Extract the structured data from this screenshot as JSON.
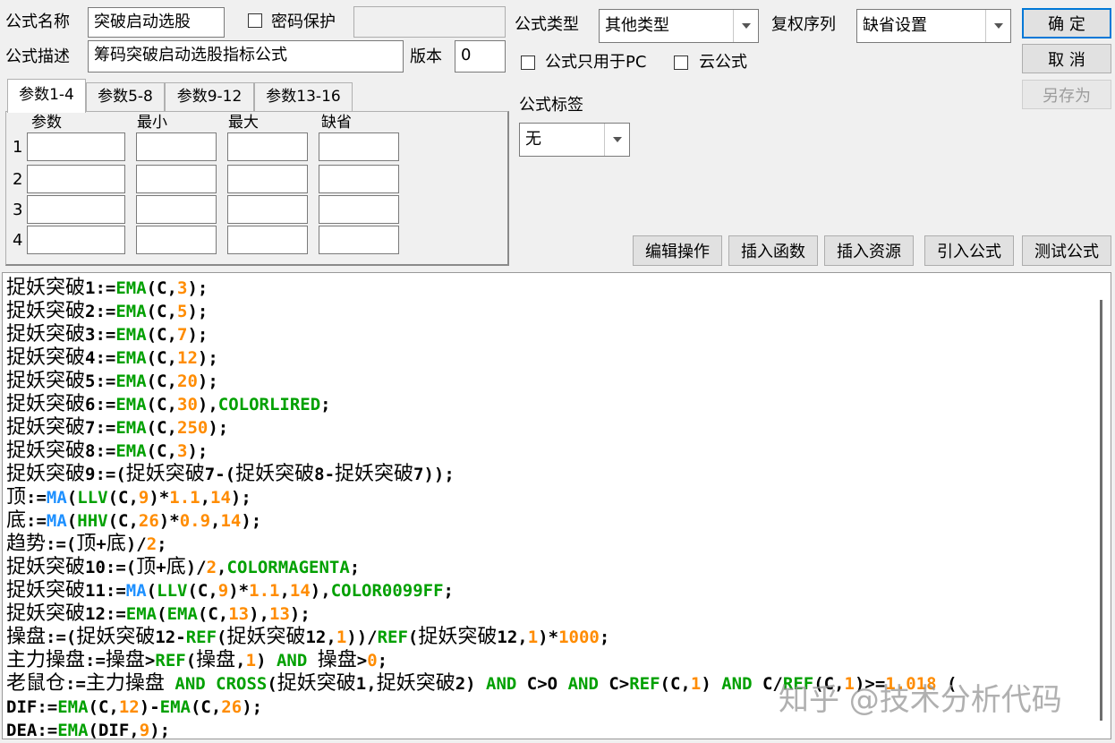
{
  "form": {
    "name_label": "公式名称",
    "name_value": "突破启动选股",
    "password_label": "密码保护",
    "desc_label": "公式描述",
    "desc_value": "筹码突破启动选股指标公式",
    "version_label": "版本",
    "version_value": "0",
    "type_label": "公式类型",
    "type_value": "其他类型",
    "rights_label": "复权序列",
    "rights_value": "缺省设置",
    "pc_only_label": "公式只用于PC",
    "cloud_label": "云公式",
    "tag_label": "公式标签",
    "tag_value": "无"
  },
  "buttons": {
    "ok": "确 定",
    "cancel": "取 消",
    "save_as": "另存为",
    "edit": "编辑操作",
    "insert_func": "插入函数",
    "insert_res": "插入资源",
    "import": "引入公式",
    "test": "测试公式"
  },
  "tabs": [
    {
      "label": "参数1-4"
    },
    {
      "label": "参数5-8"
    },
    {
      "label": "参数9-12"
    },
    {
      "label": "参数13-16"
    }
  ],
  "params": {
    "headers": [
      "参数",
      "最小",
      "最大",
      "缺省"
    ],
    "rows": [
      "1",
      "2",
      "3",
      "4"
    ]
  },
  "colors": {
    "func": "#00a000",
    "func_blue": "#1e90ff",
    "num": "#ff8c00",
    "text": "#000000"
  },
  "code_lines": [
    [
      [
        "c",
        "捉妖突破"
      ],
      [
        "t",
        "1:="
      ],
      [
        "f",
        "EMA"
      ],
      [
        "t",
        "(C,"
      ],
      [
        "n",
        "3"
      ],
      [
        "t",
        ");"
      ]
    ],
    [
      [
        "c",
        "捉妖突破"
      ],
      [
        "t",
        "2:="
      ],
      [
        "f",
        "EMA"
      ],
      [
        "t",
        "(C,"
      ],
      [
        "n",
        "5"
      ],
      [
        "t",
        ");"
      ]
    ],
    [
      [
        "c",
        "捉妖突破"
      ],
      [
        "t",
        "3:="
      ],
      [
        "f",
        "EMA"
      ],
      [
        "t",
        "(C,"
      ],
      [
        "n",
        "7"
      ],
      [
        "t",
        ");"
      ]
    ],
    [
      [
        "c",
        "捉妖突破"
      ],
      [
        "t",
        "4:="
      ],
      [
        "f",
        "EMA"
      ],
      [
        "t",
        "(C,"
      ],
      [
        "n",
        "12"
      ],
      [
        "t",
        ");"
      ]
    ],
    [
      [
        "c",
        "捉妖突破"
      ],
      [
        "t",
        "5:="
      ],
      [
        "f",
        "EMA"
      ],
      [
        "t",
        "(C,"
      ],
      [
        "n",
        "20"
      ],
      [
        "t",
        ");"
      ]
    ],
    [
      [
        "c",
        "捉妖突破"
      ],
      [
        "t",
        "6:="
      ],
      [
        "f",
        "EMA"
      ],
      [
        "t",
        "(C,"
      ],
      [
        "n",
        "30"
      ],
      [
        "t",
        "),"
      ],
      [
        "f",
        "COLORLIRED"
      ],
      [
        "t",
        ";"
      ]
    ],
    [
      [
        "c",
        "捉妖突破"
      ],
      [
        "t",
        "7:="
      ],
      [
        "f",
        "EMA"
      ],
      [
        "t",
        "(C,"
      ],
      [
        "n",
        "250"
      ],
      [
        "t",
        ");"
      ]
    ],
    [
      [
        "c",
        "捉妖突破"
      ],
      [
        "t",
        "8:="
      ],
      [
        "f",
        "EMA"
      ],
      [
        "t",
        "(C,"
      ],
      [
        "n",
        "3"
      ],
      [
        "t",
        ");"
      ]
    ],
    [
      [
        "c",
        "捉妖突破"
      ],
      [
        "t",
        "9:=("
      ],
      [
        "c",
        "捉妖突破"
      ],
      [
        "t",
        "7-("
      ],
      [
        "c",
        "捉妖突破"
      ],
      [
        "t",
        "8-"
      ],
      [
        "c",
        "捉妖突破"
      ],
      [
        "t",
        "7));"
      ]
    ],
    [
      [
        "c",
        "顶"
      ],
      [
        "t",
        ":="
      ],
      [
        "b",
        "MA"
      ],
      [
        "t",
        "("
      ],
      [
        "f",
        "LLV"
      ],
      [
        "t",
        "(C,"
      ],
      [
        "n",
        "9"
      ],
      [
        "t",
        ")*"
      ],
      [
        "n",
        "1.1"
      ],
      [
        "t",
        ","
      ],
      [
        "n",
        "14"
      ],
      [
        "t",
        ");"
      ]
    ],
    [
      [
        "c",
        "底"
      ],
      [
        "t",
        ":="
      ],
      [
        "b",
        "MA"
      ],
      [
        "t",
        "("
      ],
      [
        "f",
        "HHV"
      ],
      [
        "t",
        "(C,"
      ],
      [
        "n",
        "26"
      ],
      [
        "t",
        ")*"
      ],
      [
        "n",
        "0.9"
      ],
      [
        "t",
        ","
      ],
      [
        "n",
        "14"
      ],
      [
        "t",
        ");"
      ]
    ],
    [
      [
        "c",
        "趋势"
      ],
      [
        "t",
        ":=("
      ],
      [
        "c",
        "顶"
      ],
      [
        "t",
        "+"
      ],
      [
        "c",
        "底"
      ],
      [
        "t",
        ")/"
      ],
      [
        "n",
        "2"
      ],
      [
        "t",
        ";"
      ]
    ],
    [
      [
        "c",
        "捉妖突破"
      ],
      [
        "t",
        "10:=("
      ],
      [
        "c",
        "顶"
      ],
      [
        "t",
        "+"
      ],
      [
        "c",
        "底"
      ],
      [
        "t",
        ")/"
      ],
      [
        "n",
        "2"
      ],
      [
        "t",
        ","
      ],
      [
        "f",
        "COLORMAGENTA"
      ],
      [
        "t",
        ";"
      ]
    ],
    [
      [
        "c",
        "捉妖突破"
      ],
      [
        "t",
        "11:="
      ],
      [
        "b",
        "MA"
      ],
      [
        "t",
        "("
      ],
      [
        "f",
        "LLV"
      ],
      [
        "t",
        "(C,"
      ],
      [
        "n",
        "9"
      ],
      [
        "t",
        ")*"
      ],
      [
        "n",
        "1.1"
      ],
      [
        "t",
        ","
      ],
      [
        "n",
        "14"
      ],
      [
        "t",
        "),"
      ],
      [
        "f",
        "COLOR0099FF"
      ],
      [
        "t",
        ";"
      ]
    ],
    [
      [
        "c",
        "捉妖突破"
      ],
      [
        "t",
        "12:="
      ],
      [
        "f",
        "EMA"
      ],
      [
        "t",
        "("
      ],
      [
        "f",
        "EMA"
      ],
      [
        "t",
        "(C,"
      ],
      [
        "n",
        "13"
      ],
      [
        "t",
        "),"
      ],
      [
        "n",
        "13"
      ],
      [
        "t",
        ");"
      ]
    ],
    [
      [
        "c",
        "操盘"
      ],
      [
        "t",
        ":=("
      ],
      [
        "c",
        "捉妖突破"
      ],
      [
        "t",
        "12-"
      ],
      [
        "f",
        "REF"
      ],
      [
        "t",
        "("
      ],
      [
        "c",
        "捉妖突破"
      ],
      [
        "t",
        "12,"
      ],
      [
        "n",
        "1"
      ],
      [
        "t",
        "))/"
      ],
      [
        "f",
        "REF"
      ],
      [
        "t",
        "("
      ],
      [
        "c",
        "捉妖突破"
      ],
      [
        "t",
        "12,"
      ],
      [
        "n",
        "1"
      ],
      [
        "t",
        ")*"
      ],
      [
        "n",
        "1000"
      ],
      [
        "t",
        ";"
      ]
    ],
    [
      [
        "c",
        "主力操盘"
      ],
      [
        "t",
        ":="
      ],
      [
        "c",
        "操盘"
      ],
      [
        "t",
        ">"
      ],
      [
        "f",
        "REF"
      ],
      [
        "t",
        "("
      ],
      [
        "c",
        "操盘"
      ],
      [
        "t",
        ","
      ],
      [
        "n",
        "1"
      ],
      [
        "t",
        ") "
      ],
      [
        "f",
        "AND"
      ],
      [
        "t",
        " "
      ],
      [
        "c",
        "操盘"
      ],
      [
        "t",
        ">"
      ],
      [
        "n",
        "0"
      ],
      [
        "t",
        ";"
      ]
    ],
    [
      [
        "c",
        "老鼠仓"
      ],
      [
        "t",
        ":="
      ],
      [
        "c",
        "主力操盘"
      ],
      [
        "t",
        " "
      ],
      [
        "f",
        "AND CROSS"
      ],
      [
        "t",
        "("
      ],
      [
        "c",
        "捉妖突破"
      ],
      [
        "t",
        "1,"
      ],
      [
        "c",
        "捉妖突破"
      ],
      [
        "t",
        "2) "
      ],
      [
        "f",
        "AND"
      ],
      [
        "t",
        " C>O "
      ],
      [
        "f",
        "AND"
      ],
      [
        "t",
        " C>"
      ],
      [
        "f",
        "REF"
      ],
      [
        "t",
        "(C,"
      ],
      [
        "n",
        "1"
      ],
      [
        "t",
        ") "
      ],
      [
        "f",
        "AND"
      ],
      [
        "t",
        " C/"
      ],
      [
        "f",
        "REF"
      ],
      [
        "t",
        "(C,"
      ],
      [
        "n",
        "1"
      ],
      [
        "t",
        ")>="
      ],
      [
        "n",
        "1.018"
      ],
      [
        "t",
        " ("
      ]
    ],
    [
      [
        "t",
        "DIF:="
      ],
      [
        "f",
        "EMA"
      ],
      [
        "t",
        "(C,"
      ],
      [
        "n",
        "12"
      ],
      [
        "t",
        ")-"
      ],
      [
        "f",
        "EMA"
      ],
      [
        "t",
        "(C,"
      ],
      [
        "n",
        "26"
      ],
      [
        "t",
        ");"
      ]
    ],
    [
      [
        "t",
        "DEA:="
      ],
      [
        "f",
        "EMA"
      ],
      [
        "t",
        "(DIF,"
      ],
      [
        "n",
        "9"
      ],
      [
        "t",
        ");"
      ]
    ]
  ],
  "watermark": "知乎 @技术分析代码"
}
